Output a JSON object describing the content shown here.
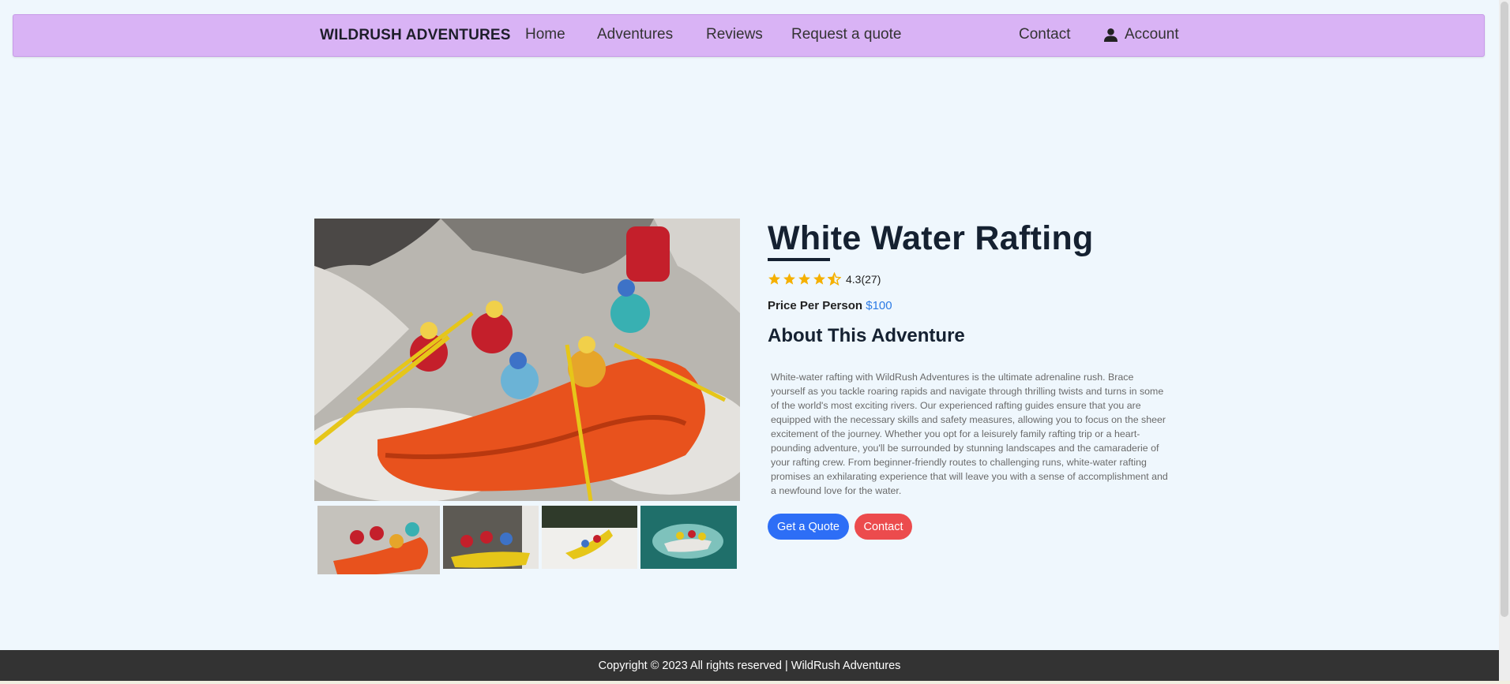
{
  "navbar": {
    "brand": "WILDRUSH ADVENTURES",
    "links": [
      "Home",
      "Adventures",
      "Reviews",
      "Request a quote"
    ],
    "contact": "Contact",
    "account": "Account",
    "account_icon": "user-icon",
    "background_color": "#d9b3f5"
  },
  "adventure": {
    "title": "White Water Rafting",
    "rating_value": 4.3,
    "rating_max": 5,
    "rating_text": "4.3(27)",
    "price_label": "Price Per Person",
    "price": "$100",
    "about_heading": "About This Adventure",
    "description": "White-water rafting with WildRush Adventures is the ultimate adrenaline rush. Brace yourself as you tackle roaring rapids and navigate through thrilling twists and turns in some of the world's most exciting rivers. Our experienced rafting guides ensure that you are equipped with the necessary skills and safety measures, allowing you to focus on the sheer excitement of the journey. Whether you opt for a leisurely family rafting trip or a heart-pounding adventure, you'll be surrounded by stunning landscapes and the camaraderie of your rafting crew. From beginner-friendly routes to challenging runs, white-water rafting promises an exhilarating experience that will leave you with a sense of accomplishment and a newfound love for the water.",
    "quote_button": "Get a Quote",
    "contact_button": "Contact",
    "star_color": "#f5b000",
    "price_color": "#2c7be5"
  },
  "gallery": {
    "main_image": "rafting-photo",
    "thumbnails": [
      "rafting-photo",
      "rafting-photo",
      "rafting-photo",
      "rafting-photo"
    ]
  },
  "footer": {
    "text": "Copyright © 2023 All rights reserved | WildRush Adventures"
  }
}
